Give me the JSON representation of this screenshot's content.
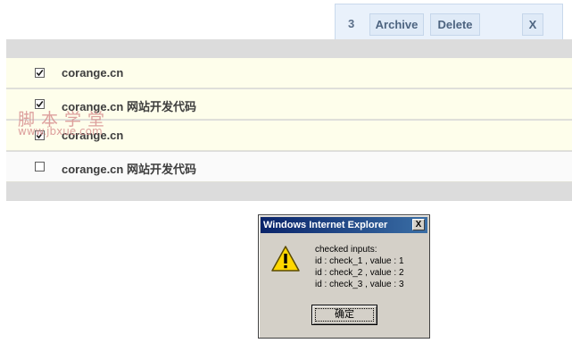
{
  "action_bar": {
    "selected_count": "3",
    "archive_label": "Archive",
    "delete_label": "Delete",
    "close_label": "X"
  },
  "list": {
    "rows": [
      {
        "label": "corange.cn",
        "checked": true
      },
      {
        "label": "corange.cn 网站开发代码",
        "checked": true
      },
      {
        "label": "corange.cn",
        "checked": true
      },
      {
        "label": "corange.cn 网站开发代码",
        "checked": false
      }
    ]
  },
  "watermark": {
    "chinese": "脚本学堂",
    "url": "www.jbxue.com"
  },
  "dialog": {
    "title": "Windows Internet Explorer",
    "close_label": "X",
    "icon": "warning-icon",
    "lines": [
      "checked inputs:",
      "id : check_1 , value : 1",
      "id : check_2 , value : 2",
      "id : check_3 , value : 3"
    ],
    "ok_label": "确定"
  },
  "colors": {
    "action_bar_bg": "#e9f1fb",
    "row_highlight": "#fefeeb",
    "title_bar": "#0a246a"
  }
}
